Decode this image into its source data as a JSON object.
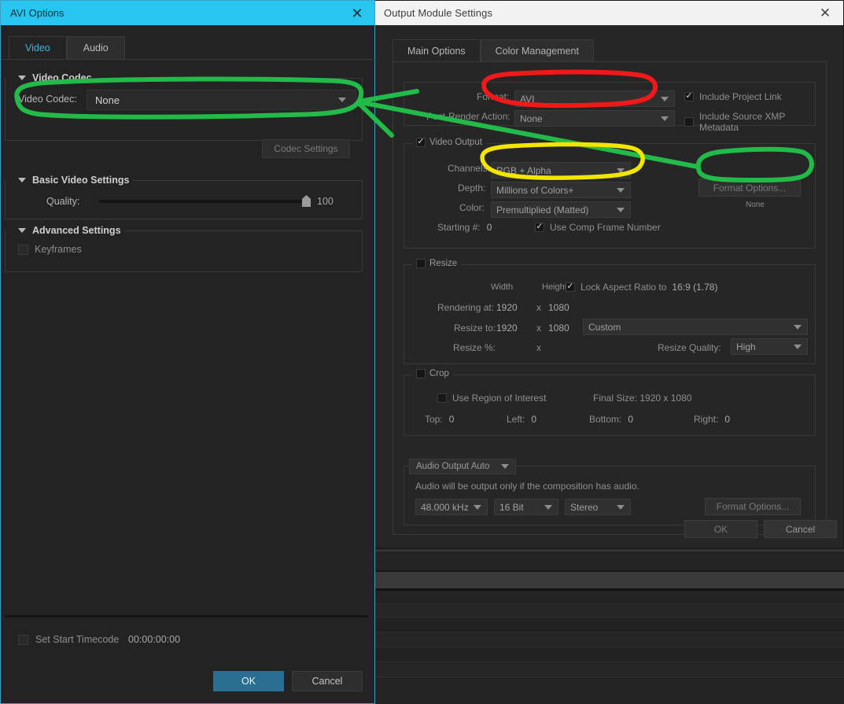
{
  "avi_dialog": {
    "title": "AVI Options",
    "close_icon": "close-icon",
    "tabs": [
      {
        "label": "Video",
        "active": true
      },
      {
        "label": "Audio",
        "active": false
      }
    ],
    "sections": {
      "video_codec": {
        "heading": "Video Codec",
        "codec_label": "Video Codec:",
        "codec_value": "None",
        "codec_settings_button": "Codec Settings"
      },
      "basic_video_settings": {
        "heading": "Basic Video Settings",
        "quality_label": "Quality:",
        "quality_value": "100"
      },
      "advanced_settings": {
        "heading": "Advanced Settings",
        "keyframes_label": "Keyframes",
        "keyframes_checked": false
      }
    },
    "footer": {
      "set_start_timecode_label": "Set Start Timecode",
      "set_start_timecode_checked": false,
      "timecode_value": "00:00:00:00",
      "ok_label": "OK",
      "cancel_label": "Cancel"
    }
  },
  "output_module_dialog": {
    "title": "Output Module Settings",
    "close_icon": "close-icon",
    "tabs": [
      {
        "label": "Main Options",
        "active": true
      },
      {
        "label": "Color Management",
        "active": false
      }
    ],
    "format_group": {
      "format_label": "Format:",
      "format_value": "AVI",
      "post_render_label": "Post-Render Action:",
      "post_render_value": "None",
      "include_project_link_label": "Include Project Link",
      "include_project_link_checked": true,
      "include_xmp_label": "Include Source XMP Metadata",
      "include_xmp_checked": false
    },
    "video_output_group": {
      "legend": "Video Output",
      "legend_checked": true,
      "channels_label": "Channels:",
      "channels_value": "RGB + Alpha",
      "depth_label": "Depth:",
      "depth_value": "Millions of Colors+",
      "color_label": "Color:",
      "color_value": "Premultiplied (Matted)",
      "starting_num_label": "Starting #:",
      "starting_num_value": "0",
      "use_comp_frame_label": "Use Comp Frame Number",
      "use_comp_frame_checked": true,
      "format_options_button": "Format Options...",
      "format_options_status": "None"
    },
    "resize_group": {
      "legend": "Resize",
      "legend_checked": false,
      "width_header": "Width",
      "height_header": "Height",
      "lock_aspect_label": "Lock Aspect Ratio to",
      "lock_aspect_value": "16:9 (1.78)",
      "lock_aspect_checked": true,
      "rendering_at_label": "Rendering at:",
      "rendering_at_width": "1920",
      "rendering_at_height": "1080",
      "resize_to_label": "Resize to:",
      "resize_to_width": "1920",
      "resize_to_height": "1080",
      "resize_preset_value": "Custom",
      "resize_pct_label": "Resize %:",
      "times_symbol": "x",
      "resize_quality_label": "Resize Quality:",
      "resize_quality_value": "High"
    },
    "crop_group": {
      "legend": "Crop",
      "legend_checked": false,
      "use_roi_label": "Use Region of Interest",
      "use_roi_checked": false,
      "final_size_text": "Final Size: 1920 x 1080",
      "top_label": "Top:",
      "top_value": "0",
      "left_label": "Left:",
      "left_value": "0",
      "bottom_label": "Bottom:",
      "bottom_value": "0",
      "right_label": "Right:",
      "right_value": "0"
    },
    "audio_group": {
      "legend": "Audio Output Auto",
      "note": "Audio will be output only if the composition has audio.",
      "rate_value": "48.000 kHz",
      "depth_value": "16 Bit",
      "channels_value": "Stereo",
      "format_options_button": "Format Options..."
    },
    "footer": {
      "ok_label": "OK",
      "cancel_label": "Cancel"
    }
  },
  "annotations": {
    "red_highlight_target": "format-dropdown",
    "yellow_highlight_target": "channels-dropdown",
    "green_highlight_targets": [
      "video-codec-dropdown",
      "format-options-button"
    ],
    "arrow_description": "green arrow from Format Options button to Video Codec dropdown",
    "colors": {
      "red": "#f01818",
      "yellow": "#f2e500",
      "green": "#22bb4a",
      "avi_titlebar": "#27c5f0",
      "primary_button": "#2a6e91"
    }
  }
}
